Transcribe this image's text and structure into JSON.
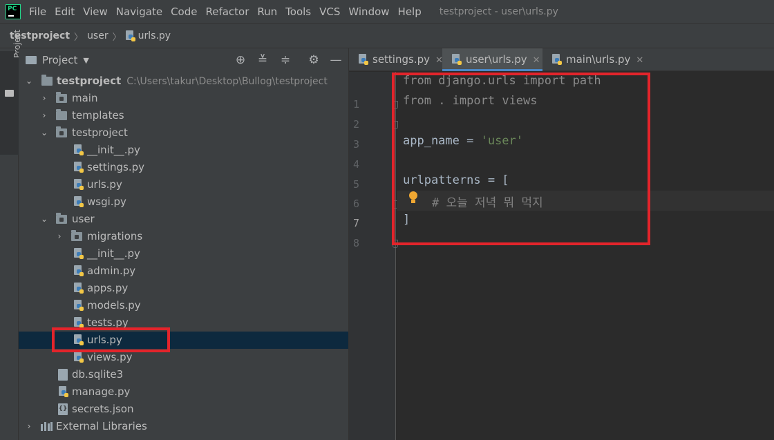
{
  "menubar": {
    "items": [
      "File",
      "Edit",
      "View",
      "Navigate",
      "Code",
      "Refactor",
      "Run",
      "Tools",
      "VCS",
      "Window",
      "Help"
    ],
    "window_title": "testproject - user\\urls.py"
  },
  "breadcrumb": {
    "project": "testproject",
    "folder": "user",
    "file": "urls.py"
  },
  "toolstrip": {
    "project_label": "Project"
  },
  "project_panel": {
    "title": "Project",
    "tree": [
      {
        "label": "testproject",
        "path": "C:\\Users\\takur\\Desktop\\Bullog\\testproject"
      },
      {
        "label": "main"
      },
      {
        "label": "templates"
      },
      {
        "label": "testproject"
      },
      {
        "label": "__init__.py"
      },
      {
        "label": "settings.py"
      },
      {
        "label": "urls.py"
      },
      {
        "label": "wsgi.py"
      },
      {
        "label": "user"
      },
      {
        "label": "migrations"
      },
      {
        "label": "__init__.py"
      },
      {
        "label": "admin.py"
      },
      {
        "label": "apps.py"
      },
      {
        "label": "models.py"
      },
      {
        "label": "tests.py"
      },
      {
        "label": "urls.py"
      },
      {
        "label": "views.py"
      },
      {
        "label": "db.sqlite3"
      },
      {
        "label": "manage.py"
      },
      {
        "label": "secrets.json"
      },
      {
        "label": "External Libraries"
      }
    ]
  },
  "editor": {
    "tabs": [
      {
        "label": "settings.py"
      },
      {
        "label": "user\\urls.py"
      },
      {
        "label": "main\\urls.py"
      }
    ],
    "line_numbers": [
      "1",
      "2",
      "3",
      "4",
      "5",
      "6",
      "7",
      "8"
    ],
    "code": {
      "l1_kw1": "from",
      "l1_mid": " django.urls ",
      "l1_kw2": "import",
      "l1_end": " path",
      "l2_kw1": "from",
      "l2_mid": " . ",
      "l2_kw2": "import",
      "l2_end": " views",
      "l4_a": "app_name = ",
      "l4_str": "'user'",
      "l6": "urlpatterns = [",
      "l7_comment": "# 오늘 저녁 뭐 먹지",
      "l8": "]"
    }
  },
  "colors": {
    "highlight_red": "#e3242b",
    "selection": "#0d293e",
    "accent_tab": "#4a88c7"
  }
}
